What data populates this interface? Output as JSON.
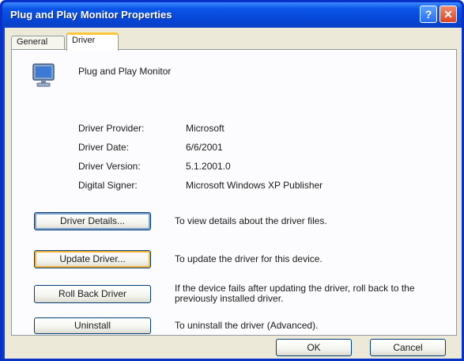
{
  "window": {
    "title": "Plug and Play Monitor Properties",
    "help_label": "?",
    "close_label": "✕"
  },
  "tabs": [
    {
      "label": "General"
    },
    {
      "label": "Driver"
    }
  ],
  "device": {
    "icon": "monitor-icon",
    "name": "Plug and Play Monitor"
  },
  "fields": [
    {
      "label": "Driver Provider:",
      "value": "Microsoft"
    },
    {
      "label": "Driver Date:",
      "value": "6/6/2001"
    },
    {
      "label": "Driver Version:",
      "value": "5.1.2001.0"
    },
    {
      "label": "Digital Signer:",
      "value": "Microsoft Windows XP Publisher"
    }
  ],
  "actions": [
    {
      "label": "Driver Details...",
      "description": "To view details about the driver files."
    },
    {
      "label": "Update Driver...",
      "description": "To update the driver for this device."
    },
    {
      "label": "Roll Back Driver",
      "description": "If the device fails after updating the driver, roll back to the previously installed driver."
    },
    {
      "label": "Uninstall",
      "description": "To uninstall the driver (Advanced)."
    }
  ],
  "footer": {
    "ok_label": "OK",
    "cancel_label": "Cancel"
  }
}
